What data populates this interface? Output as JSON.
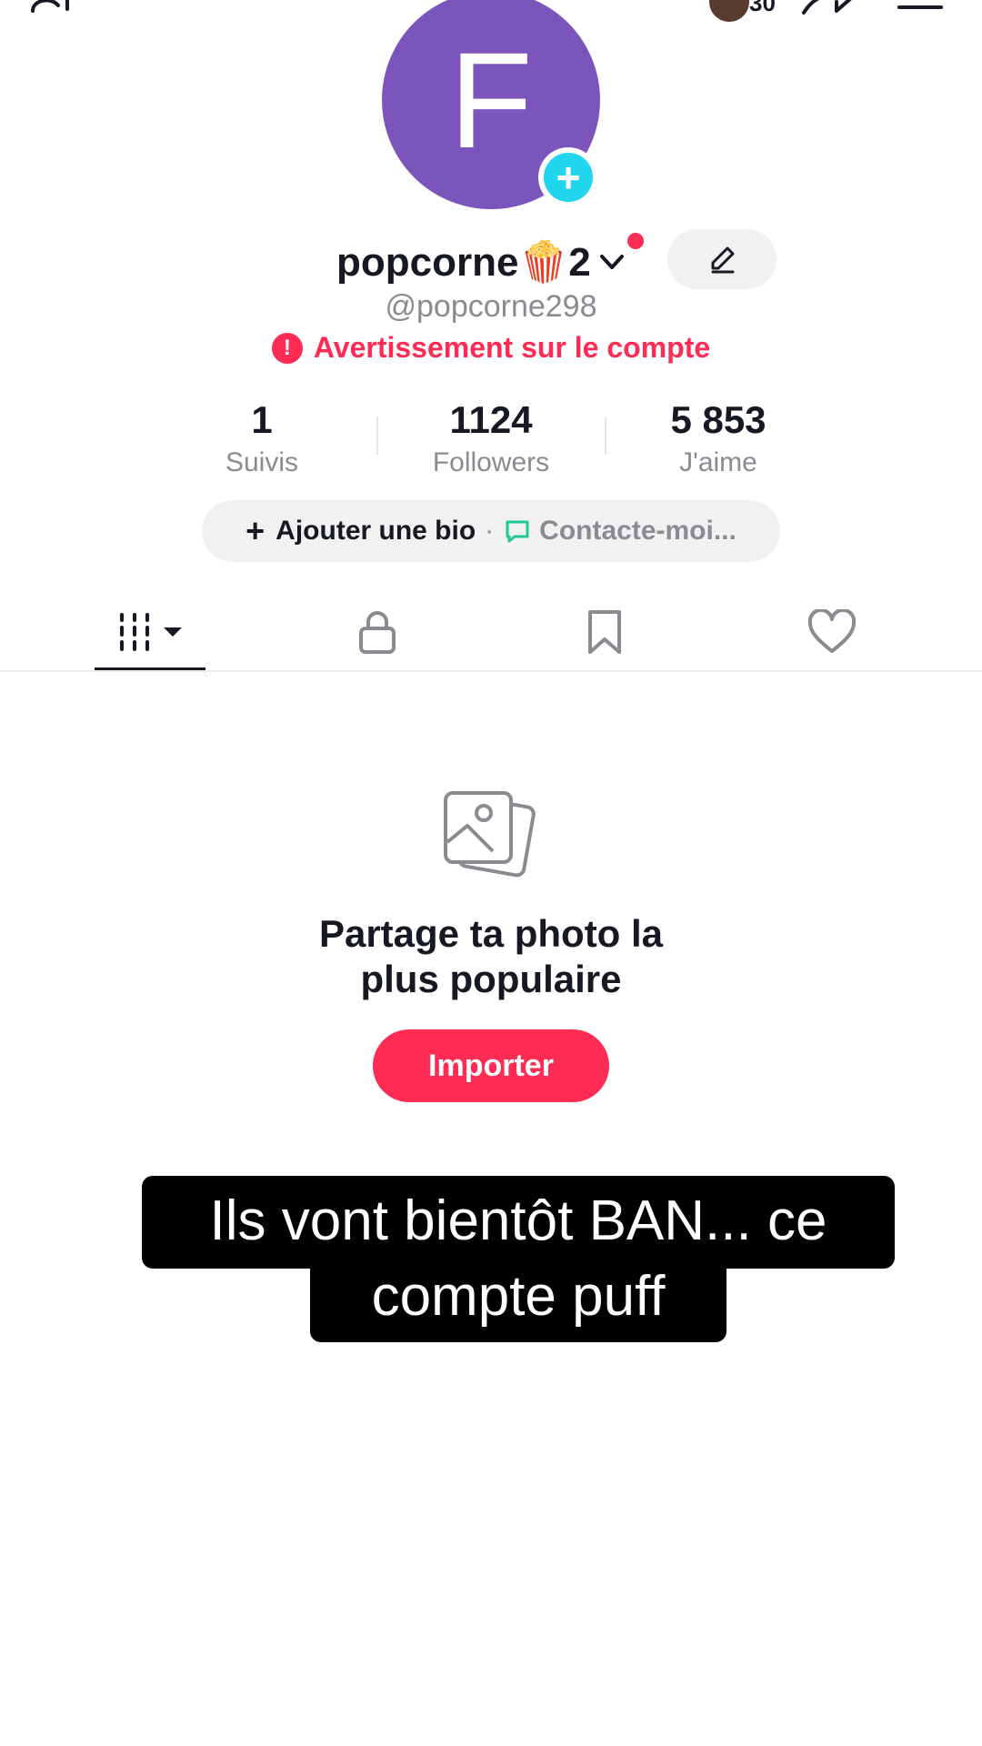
{
  "header": {
    "story_count": "30"
  },
  "profile": {
    "avatar_letter": "F",
    "display_name": "popcorne🍿2",
    "username": "@popcorne298",
    "warning": "Avertissement sur le compte"
  },
  "stats": [
    {
      "value": "1",
      "label": "Suivis"
    },
    {
      "value": "1124",
      "label": "Followers"
    },
    {
      "value": "5 853",
      "label": "J'aime"
    }
  ],
  "bio": {
    "add_label": "Ajouter une bio",
    "separator": "·",
    "contact_label": "Contacte-moi..."
  },
  "tabs": [
    {
      "icon": "grid-icon",
      "active": true
    },
    {
      "icon": "lock-icon",
      "active": false
    },
    {
      "icon": "bookmark-icon",
      "active": false
    },
    {
      "icon": "heart-icon",
      "active": false
    }
  ],
  "empty_state": {
    "title": "Partage ta photo la\nplus populaire",
    "button_label": "Importer"
  },
  "caption": {
    "line1": "Ils vont bientôt BAN... ce",
    "line2": "compte puff"
  },
  "colors": {
    "accent": "#fe2c55",
    "avatar_bg": "#7b55bb",
    "add_badge": "#20d5ec",
    "contact_icon": "#20c997"
  }
}
